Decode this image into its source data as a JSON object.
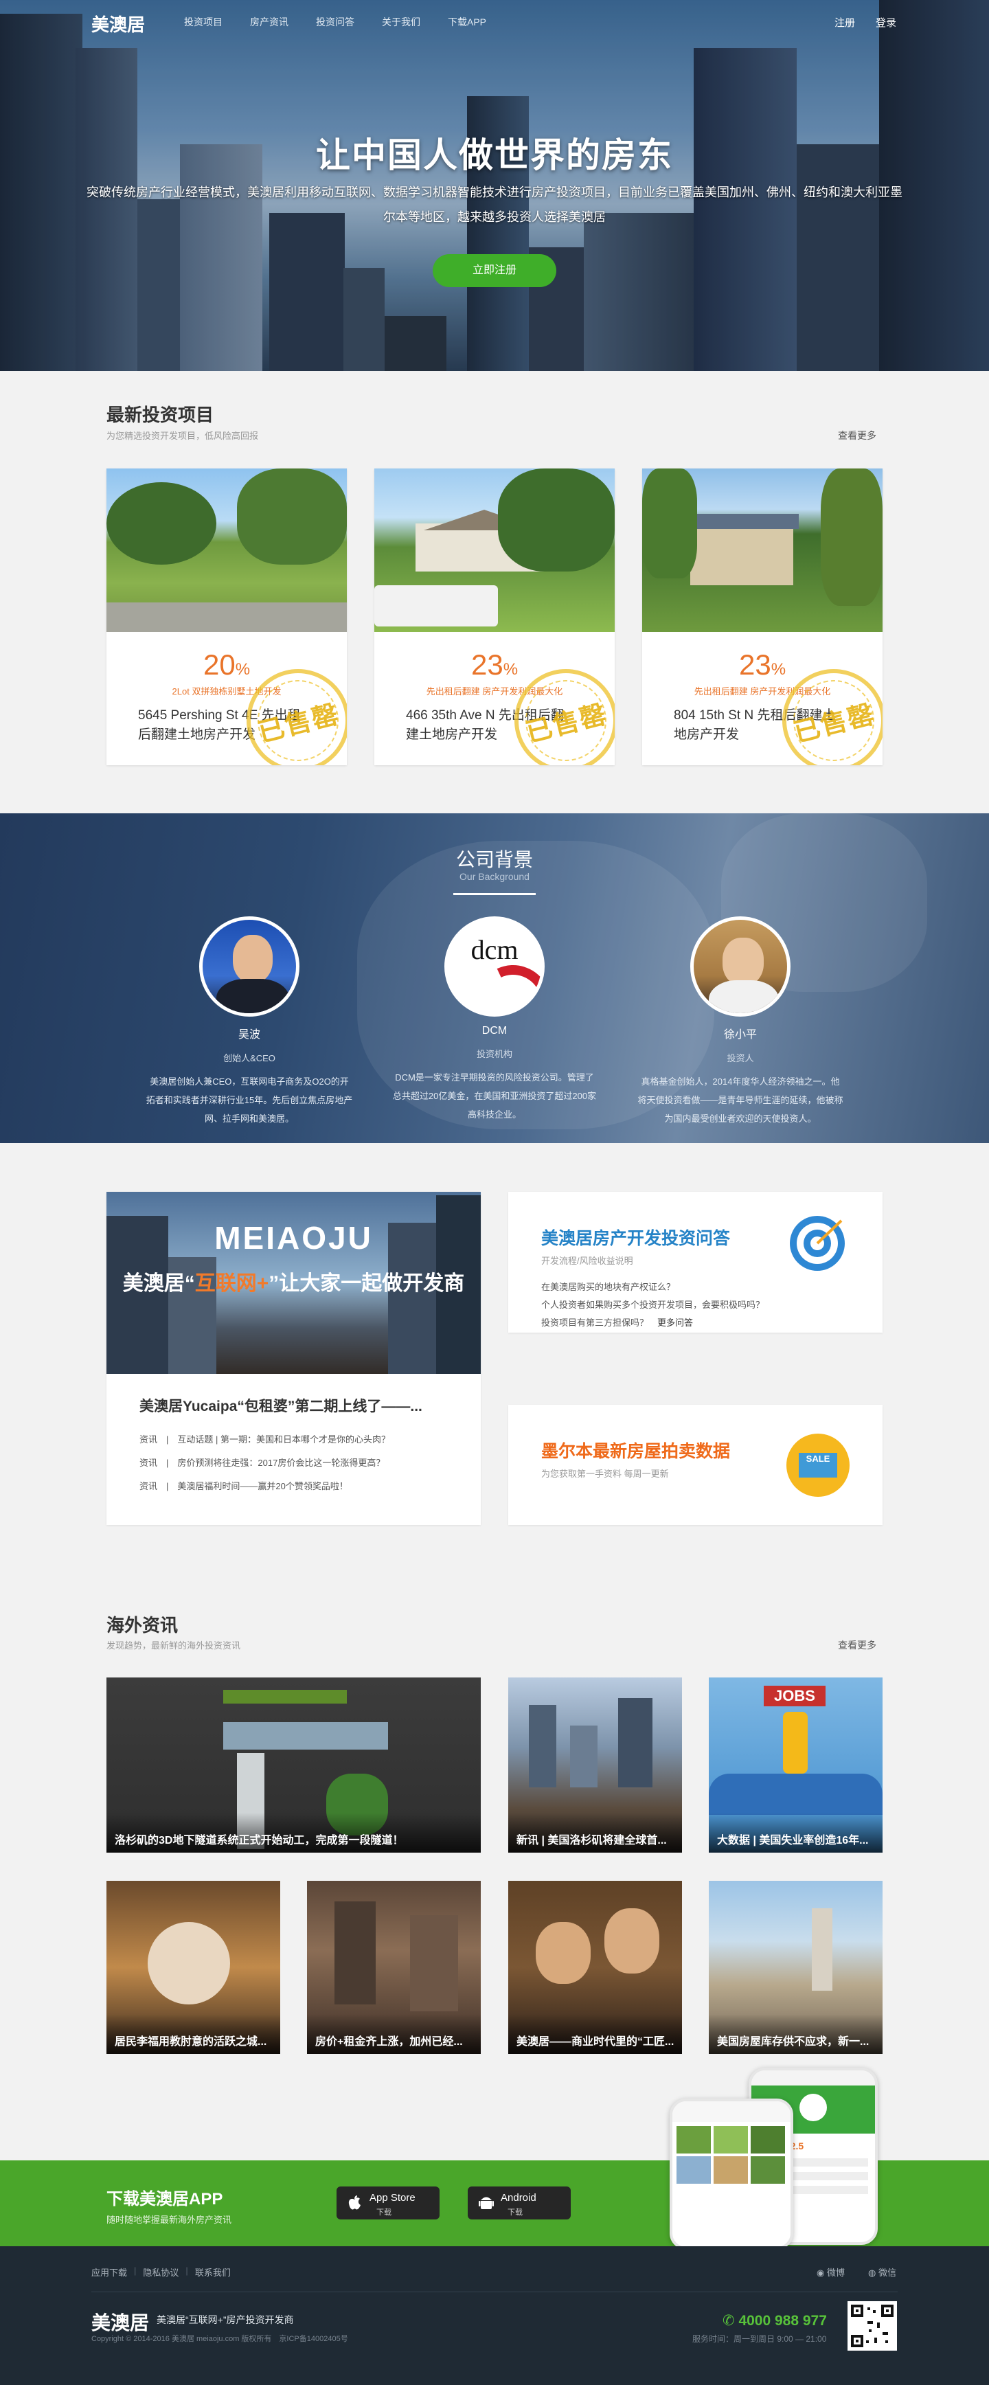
{
  "brand": "美澳居",
  "nav": {
    "links": [
      "投资项目",
      "房产资讯",
      "投资问答",
      "关于我们",
      "下载APP"
    ],
    "login": "注册",
    "register": "登录"
  },
  "hero": {
    "title": "让中国人做世界的房东",
    "subtitle": "突破传统房产行业经营模式，美澳居利用移动互联网、数据学习机器智能技术进行房产投资项目，目前业务已覆盖美国加州、佛州、纽约和澳大利亚墨尔本等地区，越来越多投资人选择美澳居",
    "cta": "立即注册"
  },
  "projects": {
    "title": "最新投资项目",
    "subtitle": "为您精选投资开发项目，低风险高回报",
    "more": "查看更多",
    "items": [
      {
        "pct": "20",
        "tag": "2Lot 双拼独栋别墅土地开发",
        "name": "5645 Pershing St 4E 先出租后翻建土地房产开发",
        "stamp": "已售罄"
      },
      {
        "pct": "23",
        "tag": "先出租后翻建 房产开发利润最大化",
        "name": "466 35th Ave N 先出租后翻建土地房产开发",
        "stamp": "已售罄"
      },
      {
        "pct": "23",
        "tag": "先出租后翻建 房产开发利润最大化",
        "name": "804 15th St N 先租后翻建土地房产开发",
        "stamp": "已售罄"
      }
    ]
  },
  "background": {
    "title": "公司背景",
    "en": "Our Background",
    "people": [
      {
        "name": "吴波",
        "role": "创始人&CEO",
        "desc": [
          "美澳居创始人兼CEO，互联网电子商务及O2O的开",
          "拓者和实践者并深耕行业15年。先后创立焦点房地产",
          "网、拉手网和美澳居。"
        ]
      },
      {
        "name": "DCM",
        "role": "投资机构",
        "desc": [
          "DCM是一家专注早期投资的风险投资公司。管理了",
          "总共超过20亿美金，在美国和亚洲投资了超过200家",
          "高科技企业。"
        ]
      },
      {
        "name": "徐小平",
        "role": "投资人",
        "desc": [
          "真格基金创始人，2014年度华人经济领袖之一。他",
          "将天使投资看做——是青年导师生涯的延续，他被称",
          "为国内最受创业者欢迎的天使投资人。"
        ]
      }
    ],
    "dcm_logo": "dcm"
  },
  "feature": {
    "banner_en": "MEIAOJU",
    "banner_cn_a": "美澳居“",
    "banner_cn_b": "互联网+",
    "banner_cn_c": "”让大家一起做开发商",
    "title": "美澳居Yucaipa“包租婆”第二期上线了——...",
    "items": [
      {
        "cat": "资讯",
        "text": "互动话题 | 第一期：美国和日本哪个才是你的心头肉？"
      },
      {
        "cat": "资讯",
        "text": "房价预测将往走强：2017房价会比这一轮涨得更高？"
      },
      {
        "cat": "资讯",
        "text": "美澳居福利时间——赢并20个赞领奖品啦！"
      }
    ]
  },
  "qa": {
    "title": "美澳居房产开发投资问答",
    "subtitle": "开发流程/风险收益说明",
    "questions": [
      "在美澳居购买的地块有产权证么？",
      "个人投资者如果购买多个投资开发项目，会要积极吗吗？",
      "投资项目有第三方担保吗？"
    ],
    "more": "更多问答"
  },
  "auction": {
    "title": "墨尔本最新房屋拍卖数据",
    "subtitle": "为您获取第一手资料 每周一更新",
    "sale": "SALE"
  },
  "overseas": {
    "title": "海外资讯",
    "subtitle": "发现趋势，最新鲜的海外投资资讯",
    "more": "查看更多",
    "tiles": [
      "洛杉矶的3D地下隧道系统正式开始动工，完成第一段隧道！",
      "新讯 | 美国洛杉矶将建全球首...",
      "大数据 | 美国失业率创造16年...",
      "居民李福用教肘意的活跃之城...",
      "房价+租金齐上涨，加州已经...",
      "美澳居——商业时代里的“工匠...",
      "美国房屋库存供不应求，新一..."
    ],
    "jobs": "JOBS"
  },
  "app": {
    "title": "下载美澳居APP",
    "subtitle": "随时随地掌握最新海外房产资讯",
    "ios": "App Store",
    "android": "Android",
    "dl": "下载",
    "phone_amount": "7434262.5"
  },
  "footer": {
    "links": [
      "应用下载",
      "隐私协议",
      "联系我们"
    ],
    "weibo": "微博",
    "wechat": "微信",
    "logo": "美澳居",
    "slogan": "美澳居“互联网+”房产投资开发商",
    "copy": "Copyright © 2014-2016 美澳居 meiaoju.com 版权所有　京ICP备14002405号",
    "tel": "4000 988 977",
    "hours": "服务时间：周一到周日 9:00 — 21:00"
  }
}
